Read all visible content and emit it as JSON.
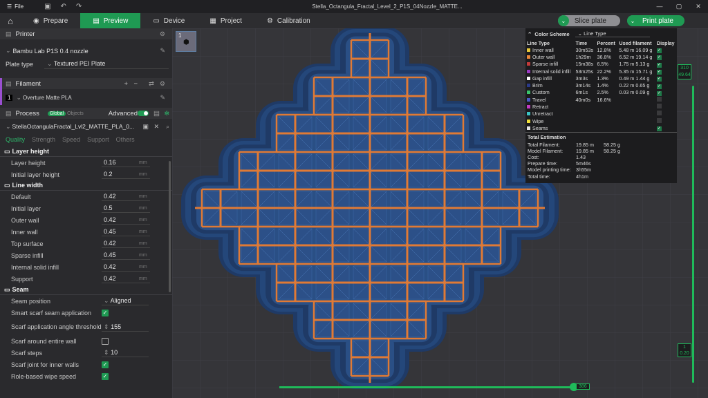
{
  "title": {
    "file_label": "File",
    "window_title": "Stella_Octangula_Fractal_Level_2_P1S_04Nozzle_MATTE..."
  },
  "tabs": {
    "prepare": "Prepare",
    "preview": "Preview",
    "device": "Device",
    "project": "Project",
    "calibration": "Calibration"
  },
  "actions": {
    "slice": "Slice plate",
    "print": "Print plate"
  },
  "printer": {
    "header": "Printer",
    "name": "Bambu Lab P1S 0.4 nozzle",
    "plate_label": "Plate type",
    "plate_value": "Textured PEI Plate"
  },
  "filament": {
    "header": "Filament",
    "index": "1",
    "name": "Overture Matte PLA"
  },
  "process": {
    "header": "Process",
    "global": "Global",
    "objects": "Objects",
    "advanced": "Advanced",
    "preset": "StellaOctangulaFractal_Lvl2_MATTE_PLA_0..."
  },
  "qtabs": [
    "Quality",
    "Strength",
    "Speed",
    "Support",
    "Others"
  ],
  "groups": {
    "layer_height": "Layer height",
    "line_width": "Line width",
    "seam": "Seam"
  },
  "params": {
    "layer_height": [
      {
        "name": "Layer height",
        "value": "0.16",
        "unit": "mm"
      },
      {
        "name": "Initial layer height",
        "value": "0.2",
        "unit": "mm"
      }
    ],
    "line_width": [
      {
        "name": "Default",
        "value": "0.42",
        "unit": "mm"
      },
      {
        "name": "Initial layer",
        "value": "0.5",
        "unit": "mm"
      },
      {
        "name": "Outer wall",
        "value": "0.42",
        "unit": "mm"
      },
      {
        "name": "Inner wall",
        "value": "0.45",
        "unit": "mm"
      },
      {
        "name": "Top surface",
        "value": "0.42",
        "unit": "mm"
      },
      {
        "name": "Sparse infill",
        "value": "0.45",
        "unit": "mm"
      },
      {
        "name": "Internal solid infill",
        "value": "0.42",
        "unit": "mm"
      },
      {
        "name": "Support",
        "value": "0.42",
        "unit": "mm"
      }
    ],
    "seam": {
      "position_label": "Seam position",
      "position_value": "Aligned",
      "smart_scarf": "Smart scarf seam application",
      "scarf_angle_label": "Scarf application angle threshold",
      "scarf_angle_value": "155",
      "scarf_entire": "Scarf around entire wall",
      "scarf_steps_label": "Scarf steps",
      "scarf_steps_value": "10",
      "scarf_inner": "Scarf joint for inner walls",
      "role_wipe": "Role-based wipe speed"
    }
  },
  "plate": {
    "number": "1"
  },
  "legend": {
    "title": "Color Scheme",
    "scheme": "Line Type",
    "headers": [
      "Line Type",
      "Time",
      "Percent",
      "Used filament",
      "Display"
    ],
    "rows": [
      {
        "name": "Inner wall",
        "color": "#e8c93a",
        "time": "30m53s",
        "percent": "12.8%",
        "used": "5.48 m  16.09 g",
        "display": true
      },
      {
        "name": "Outer wall",
        "color": "#e8863a",
        "time": "1h29m",
        "percent": "36.8%",
        "used": "6.52 m  19.14 g",
        "display": true
      },
      {
        "name": "Sparse infill",
        "color": "#c43a3a",
        "time": "15m38s",
        "percent": "6.5%",
        "used": "1.75 m  5.13 g",
        "display": true
      },
      {
        "name": "Internal solid infill",
        "color": "#9a3ac4",
        "time": "53m25s",
        "percent": "22.2%",
        "used": "5.35 m  15.71 g",
        "display": true
      },
      {
        "name": "Gap infill",
        "color": "#ffffff",
        "time": "3m3s",
        "percent": "1.3%",
        "used": "0.49 m  1.44 g",
        "display": true
      },
      {
        "name": "Brim",
        "color": "#2a3a8a",
        "time": "3m14s",
        "percent": "1.4%",
        "used": "0.22 m  0.65 g",
        "display": true
      },
      {
        "name": "Custom",
        "color": "#3ac46a",
        "time": "6m1s",
        "percent": "2.5%",
        "used": "0.03 m  0.09 g",
        "display": true
      },
      {
        "name": "Travel",
        "color": "#4a5ac4",
        "time": "40m0s",
        "percent": "16.6%",
        "used": "",
        "display": false
      },
      {
        "name": "Retract",
        "color": "#c43ac4",
        "time": "",
        "percent": "",
        "used": "",
        "display": false
      },
      {
        "name": "Unretract",
        "color": "#3ac4c4",
        "time": "",
        "percent": "",
        "used": "",
        "display": false
      },
      {
        "name": "Wipe",
        "color": "#f0e03a",
        "time": "",
        "percent": "",
        "used": "",
        "display": false
      },
      {
        "name": "Seams",
        "color": "#e6e6e6",
        "time": "",
        "percent": "",
        "used": "",
        "display": true
      }
    ],
    "totals_title": "Total Estimation",
    "totals": [
      {
        "k": "Total Filament:",
        "v1": "19.85 m",
        "v2": "58.25 g"
      },
      {
        "k": "Model Filament:",
        "v1": "19.85 m",
        "v2": "58.25 g"
      },
      {
        "k": "Cost:",
        "v1": "1.43",
        "v2": ""
      },
      {
        "k": "Prepare time:",
        "v1": "5m46s",
        "v2": ""
      },
      {
        "k": "Model printing time:",
        "v1": "3h55m",
        "v2": ""
      },
      {
        "k": "Total time:",
        "v1": "4h1m",
        "v2": ""
      }
    ]
  },
  "sliders": {
    "v_top_1": "310",
    "v_top_2": "49.64",
    "v_bot_1": "1",
    "v_bot_2": "0.20",
    "h_value": "386"
  }
}
